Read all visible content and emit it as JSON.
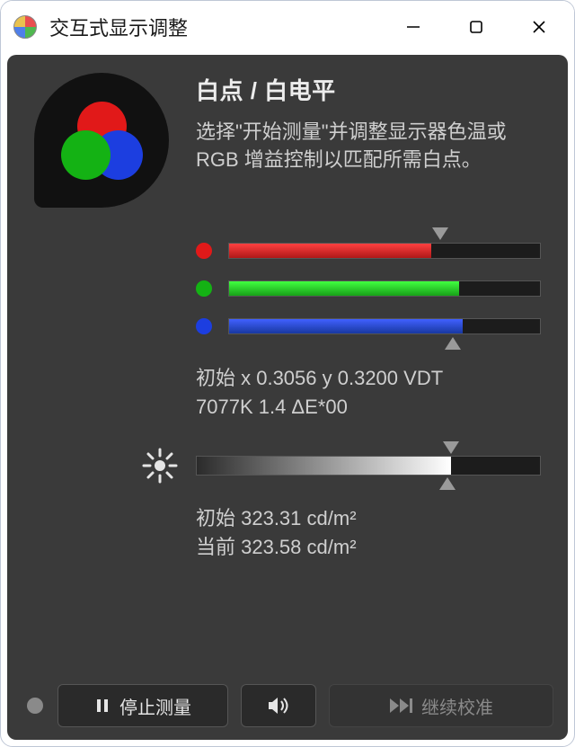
{
  "window": {
    "title": "交互式显示调整"
  },
  "hero": {
    "heading": "白点 / 白电平",
    "desc_line1": "选择\"开始测量\"并调整显示器色温或",
    "desc_line2": "RGB 增益控制以匹配所需白点。"
  },
  "rgb": {
    "top_marker_pct": 68,
    "red_pct": 65,
    "green_pct": 74,
    "blue_pct": 75,
    "bot_marker_pct": 72
  },
  "readout": {
    "line1": "初始 x 0.3056 y 0.3200 VDT",
    "line2": "7077K 1.4 ΔE*00"
  },
  "brightness": {
    "top_marker_pct": 74,
    "fill_pct": 74,
    "bot_marker_pct": 73,
    "line1": "初始 323.31 cd/m²",
    "line2": "当前 323.58 cd/m²"
  },
  "footer": {
    "stop_label": "停止测量",
    "continue_label": "继续校准"
  },
  "chart_data": [
    {
      "type": "bar",
      "title": "RGB 增益",
      "orientation": "horizontal",
      "categories": [
        "R",
        "G",
        "B"
      ],
      "values": [
        65,
        74,
        75
      ],
      "target_marker_top": 68,
      "target_marker_bottom": 72,
      "xlim": [
        0,
        100
      ],
      "colors": [
        "#e11919",
        "#14b214",
        "#1c3ee0"
      ]
    },
    {
      "type": "bar",
      "title": "亮度",
      "orientation": "horizontal",
      "categories": [
        "brightness"
      ],
      "values": [
        74
      ],
      "target_marker_top": 74,
      "target_marker_bottom": 73,
      "xlim": [
        0,
        100
      ],
      "unit": "cd/m²"
    }
  ]
}
